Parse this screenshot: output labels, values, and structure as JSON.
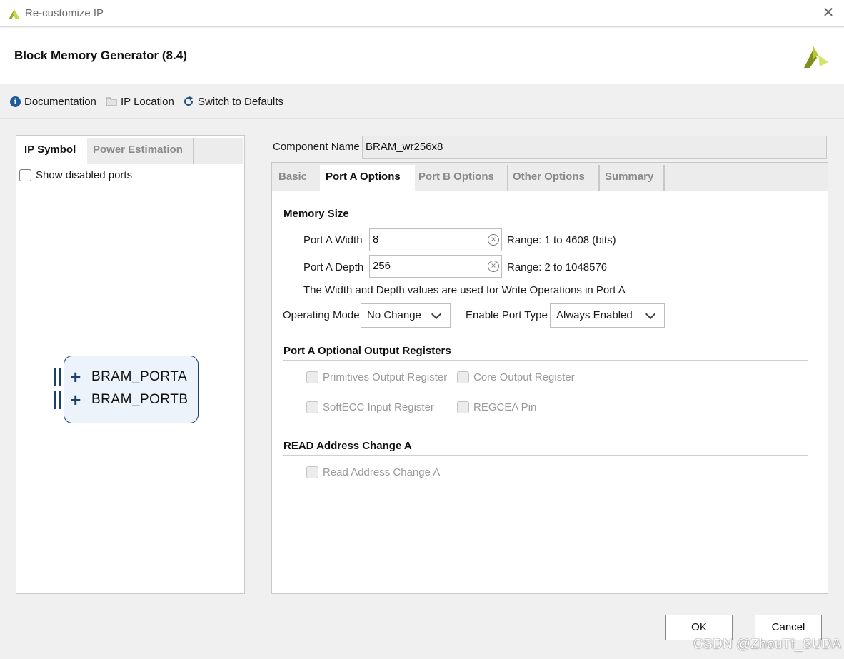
{
  "window": {
    "title": "Re-customize IP",
    "close_glyph": "✕"
  },
  "header": {
    "title": "Block Memory Generator (8.4)"
  },
  "toolbar": {
    "documentation": "Documentation",
    "ip_location": "IP Location",
    "switch_defaults": "Switch to Defaults"
  },
  "left_panel": {
    "tabs": [
      "IP Symbol",
      "Power Estimation"
    ],
    "active_tab": "IP Symbol",
    "show_disabled_ports": {
      "label": "Show disabled ports",
      "checked": false
    },
    "symbol": {
      "ports": [
        "BRAM_PORTA",
        "BRAM_PORTB"
      ]
    }
  },
  "component": {
    "label": "Component Name",
    "value": "BRAM_wr256x8"
  },
  "tabs": [
    "Basic",
    "Port A Options",
    "Port B Options",
    "Other Options",
    "Summary"
  ],
  "active_tab": "Port A Options",
  "memory_size": {
    "heading": "Memory Size",
    "width": {
      "label": "Port A Width",
      "value": "8",
      "range": "Range: 1 to 4608 (bits)"
    },
    "depth": {
      "label": "Port A Depth",
      "value": "256",
      "range": "Range: 2 to 1048576"
    },
    "note": "The Width and Depth values are used for Write Operations in Port A",
    "operating_mode": {
      "label": "Operating Mode",
      "value": "No Change"
    },
    "enable_port_type": {
      "label": "Enable Port Type",
      "value": "Always Enabled"
    }
  },
  "output_registers": {
    "heading": "Port A Optional Output Registers",
    "options": [
      "Primitives Output Register",
      "Core Output Register",
      "SoftECC Input Register",
      "REGCEA Pin"
    ]
  },
  "read_address": {
    "heading": "READ Address Change A",
    "option": "Read Address Change A"
  },
  "footer": {
    "ok": "OK",
    "cancel": "Cancel"
  },
  "watermark": "CSDN @ZhouTf_SUDA",
  "colors": {
    "accent": "#1c3f6e",
    "brand": "#b5c92a",
    "info": "#1f5a99"
  },
  "icons": [
    "xilinx-logo-icon",
    "info-icon",
    "folder-icon",
    "refresh-icon",
    "clear-icon",
    "chevron-down-icon",
    "plus-icon"
  ]
}
